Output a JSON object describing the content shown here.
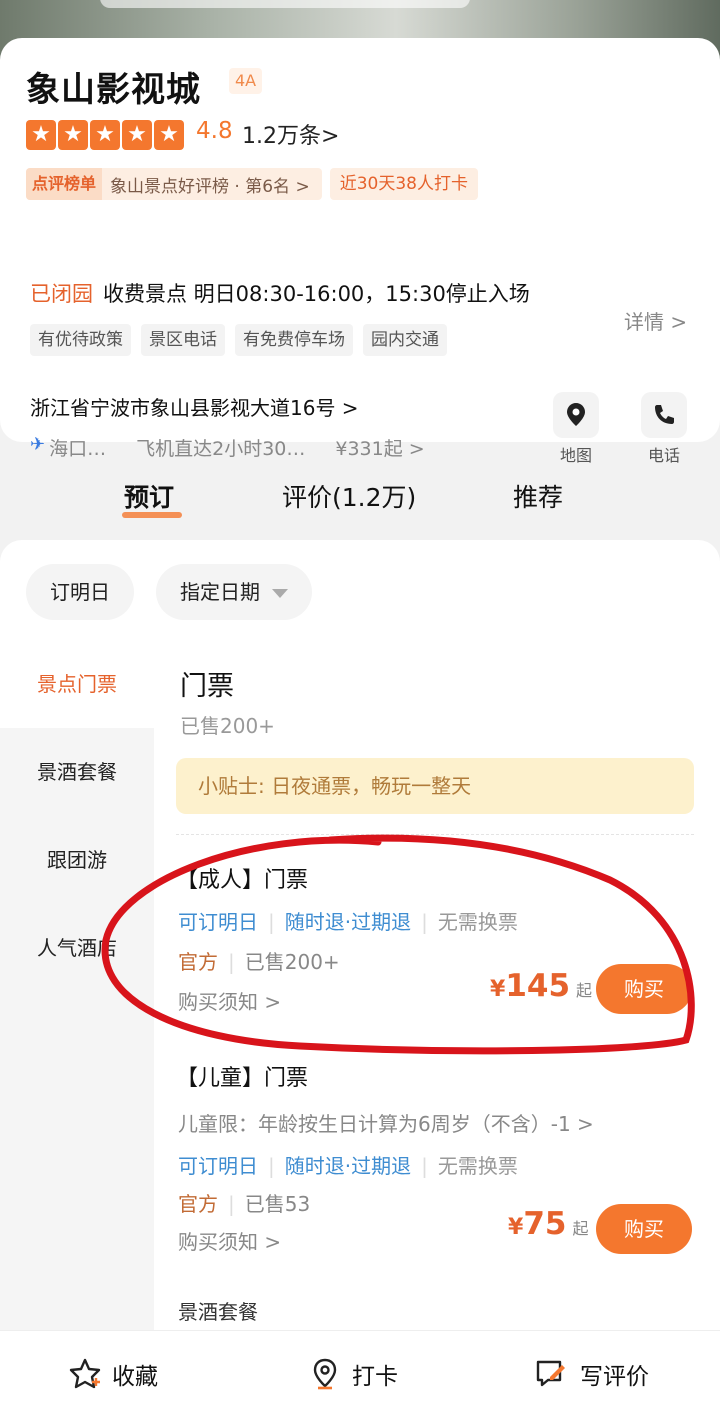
{
  "header": {
    "title": "象山影视城",
    "level": "4A",
    "rating": "4.8",
    "review_count": "1.2万条>",
    "rank_label": "点评榜单",
    "rank_text": "象山景点好评榜 · 第6名 >",
    "checkin_text": "近30天38人打卡"
  },
  "status": {
    "state": "已闭园",
    "info": "收费景点  明日08:30-16:00，15:30停止入场",
    "detail_link": "详情 >",
    "tags": [
      "有优待政策",
      "景区电话",
      "有免费停车场",
      "园内交通"
    ]
  },
  "location": {
    "address": "浙江省宁波市象山县影视大道16号 >",
    "transport_origin": "海口…",
    "transport_route": "飞机直达2小时30…",
    "transport_price": "¥331起 >",
    "map_label": "地图",
    "phone_label": "电话"
  },
  "tabs": [
    "预订",
    "评价(1.2万)",
    "推荐"
  ],
  "date_chips": {
    "tomorrow": "订明日",
    "pick_date": "指定日期"
  },
  "sidenav": [
    "景点门票",
    "景酒套餐",
    "跟团游",
    "人气酒店"
  ],
  "section": {
    "title": "门票",
    "sold": "已售200+",
    "tip": "小贴士: 日夜通票，畅玩一整天"
  },
  "tickets": [
    {
      "name": "【成人】门票",
      "policy_a": "可订明日",
      "policy_b": "随时退·过期退",
      "policy_c": "无需换票",
      "official": "官方",
      "sold": "已售200+",
      "note": "购买须知 >",
      "currency": "¥",
      "price": "145",
      "price_suffix": "起",
      "buy": "购买"
    },
    {
      "name": "【儿童】门票",
      "age_limit": "儿童限：年龄按生日计算为6周岁（不含）-1 >",
      "policy_a": "可订明日",
      "policy_b": "随时退·过期退",
      "policy_c": "无需换票",
      "official": "官方",
      "sold": "已售53",
      "note": "购买须知 >",
      "currency": "¥",
      "price": "75",
      "price_suffix": "起",
      "buy": "购买"
    }
  ],
  "next_section": "景酒套餐",
  "bottom_bar": {
    "favorite": "收藏",
    "checkin": "打卡",
    "review": "写评价"
  },
  "colors": {
    "accent": "#f4772e",
    "accent_text": "#e5622c",
    "policy_blue": "#3f8dd1",
    "annotation_red": "#d8141b"
  }
}
